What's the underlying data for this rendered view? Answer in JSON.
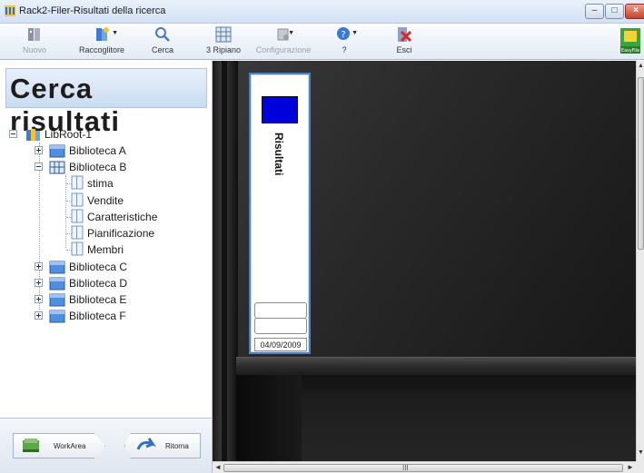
{
  "window": {
    "title": "Rack2-Filer-Risultati della ricerca",
    "controls": {
      "minimize": "–",
      "maximize": "□",
      "close": "×"
    }
  },
  "toolbar": {
    "items": [
      {
        "label": "Nuovo",
        "icon": "new-binder-icon",
        "disabled": true
      },
      {
        "label": "Raccoglitore",
        "icon": "binder-menu-icon",
        "disabled": false
      },
      {
        "label": "Cerca",
        "icon": "search-icon",
        "disabled": false
      },
      {
        "label": "3 Ripiano",
        "icon": "shelf-grid-icon",
        "disabled": false
      },
      {
        "label": "Configurazione",
        "icon": "settings-icon",
        "disabled": true
      },
      {
        "label": "?",
        "icon": "help-icon",
        "disabled": false
      },
      {
        "label": "Esci",
        "icon": "exit-icon",
        "disabled": false
      }
    ],
    "brand": "EasyFile"
  },
  "left_panel": {
    "heading": "Cerca risultati",
    "tree": {
      "root": "LibRoot-1",
      "libraries": [
        {
          "label": "Biblioteca A",
          "expanded": false
        },
        {
          "label": "Biblioteca B",
          "expanded": true,
          "children": [
            "stima",
            "Vendite",
            "Caratteristiche",
            "Pianificazione",
            "Membri"
          ]
        },
        {
          "label": "Biblioteca C",
          "expanded": false
        },
        {
          "label": "Biblioteca D",
          "expanded": false
        },
        {
          "label": "Biblioteca E",
          "expanded": false
        },
        {
          "label": "Biblioteca F",
          "expanded": false
        }
      ]
    },
    "buttons": {
      "workarea": "WorkArea",
      "ritorna": "Ritorna"
    }
  },
  "shelf": {
    "binder": {
      "spine_label": "Risultati",
      "color": "#0000d8",
      "date": "04/09/2009"
    }
  },
  "scrollbar": {
    "h_grip": "III"
  },
  "colors": {
    "accent": "#4f7fbd",
    "binder_color": "#0000d8"
  }
}
